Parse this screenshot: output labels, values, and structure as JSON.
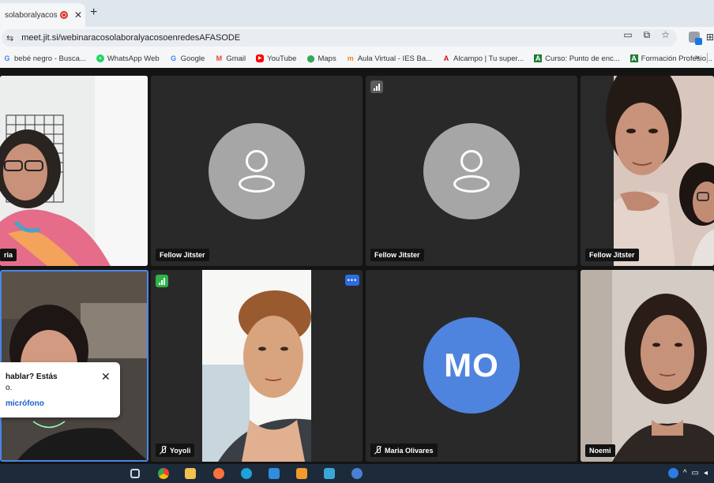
{
  "browser": {
    "tab": {
      "title": "solaboralyacos"
    },
    "url": "meet.jit.si/webinaracosolaboralyacosoenredesAFASODE",
    "bookmarks": [
      {
        "label": "bebé negro - Busca...",
        "icon": "google-g",
        "color": "#4285f4"
      },
      {
        "label": "WhatsApp Web",
        "icon": "whatsapp",
        "color": "#25d366"
      },
      {
        "label": "Google",
        "icon": "google-g",
        "color": "#4285f4"
      },
      {
        "label": "Gmail",
        "icon": "gmail",
        "color": "#ea4335"
      },
      {
        "label": "YouTube",
        "icon": "youtube",
        "color": "#ff0000"
      },
      {
        "label": "Maps",
        "icon": "maps-pin",
        "color": "#34a853"
      },
      {
        "label": "Aula Virtual - IES Ba...",
        "icon": "moodle",
        "color": "#f98012"
      },
      {
        "label": "Alcampo | Tu super...",
        "icon": "alcampo",
        "color": "#e30613"
      },
      {
        "label": "Curso: Punto de enc...",
        "icon": "course-a",
        "color": "#1e7b34"
      },
      {
        "label": "Formación Profesio...",
        "icon": "course-a",
        "color": "#1e7b34"
      }
    ],
    "bookmarks_more": "»"
  },
  "meeting": {
    "tiles": [
      {
        "name": "ria"
      },
      {
        "name": "Fellow Jitster"
      },
      {
        "name": "Fellow Jitster"
      },
      {
        "name": "Fellow Jitster"
      },
      {
        "name": ""
      },
      {
        "name": "Yoyoli"
      },
      {
        "name": "Maria Olivares",
        "initials": "MO"
      },
      {
        "name": "Noemi"
      }
    ],
    "popup": {
      "question": "hablar? Estás",
      "sub": "o.",
      "link": "micrófono"
    }
  },
  "colors": {
    "tile_bg": "#292929",
    "avatar_gray": "#a6a6a6",
    "avatar_mo": "#4f84de",
    "active_border": "#4a86e8",
    "signal_green": "#2fb34a"
  }
}
